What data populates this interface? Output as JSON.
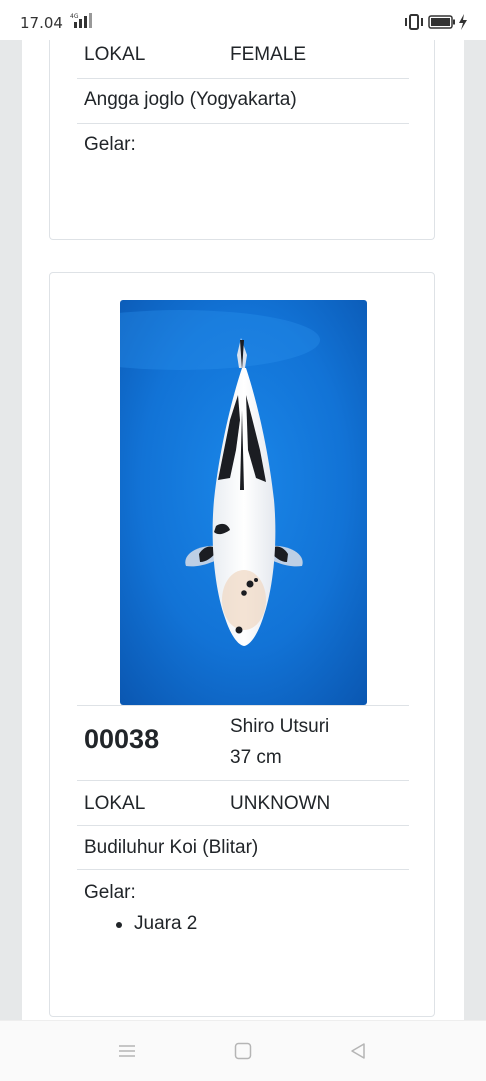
{
  "status_bar": {
    "time": "17.04",
    "network": "4G",
    "icons": [
      "signal-icon",
      "vibrate-icon",
      "battery-icon",
      "charging-icon"
    ]
  },
  "cards": [
    {
      "origin": "LOKAL",
      "gender": "FEMALE",
      "owner": "Angga joglo (Yogyakarta)",
      "gelar_label": "Gelar:",
      "titles": []
    },
    {
      "number": "00038",
      "variety": "Shiro Utsuri",
      "size": "37 cm",
      "origin": "LOKAL",
      "gender": "UNKNOWN",
      "owner": "Budiluhur Koi (Blitar)",
      "gelar_label": "Gelar:",
      "titles": [
        "Juara 2"
      ]
    }
  ],
  "nav_bar": {
    "buttons": [
      "menu-icon",
      "home-icon",
      "back-icon"
    ]
  }
}
